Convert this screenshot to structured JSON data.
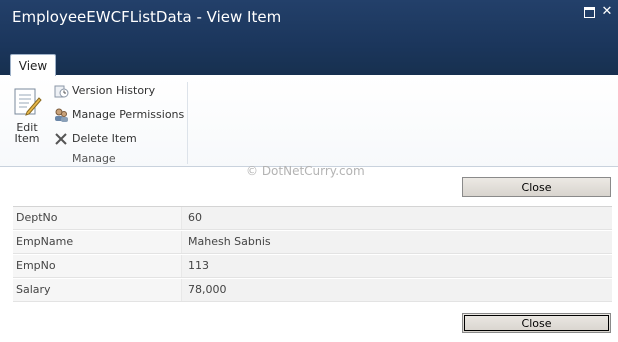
{
  "window": {
    "title": "EmployeeEWCFListData - View Item",
    "maximize_icon": "maximize-icon",
    "close_glyph": "✕"
  },
  "ribbon": {
    "tab_label": "View",
    "edit_item_label_line1": "Edit",
    "edit_item_label_line2": "Item",
    "version_history_label": "Version History",
    "manage_permissions_label": "Manage Permissions",
    "delete_item_label": "Delete Item",
    "group_label": "Manage"
  },
  "watermark": "© DotNetCurry.com",
  "close_label": "Close",
  "fields": [
    {
      "label": "DeptNo",
      "value": "60"
    },
    {
      "label": "EmpName",
      "value": "Mahesh Sabnis"
    },
    {
      "label": "EmpNo",
      "value": "113"
    },
    {
      "label": "Salary",
      "value": "78,000"
    }
  ],
  "colors": {
    "titlebar": "#1b365c",
    "ribbon_bg": "#ffffff",
    "field_bg": "#f2f2f2"
  }
}
